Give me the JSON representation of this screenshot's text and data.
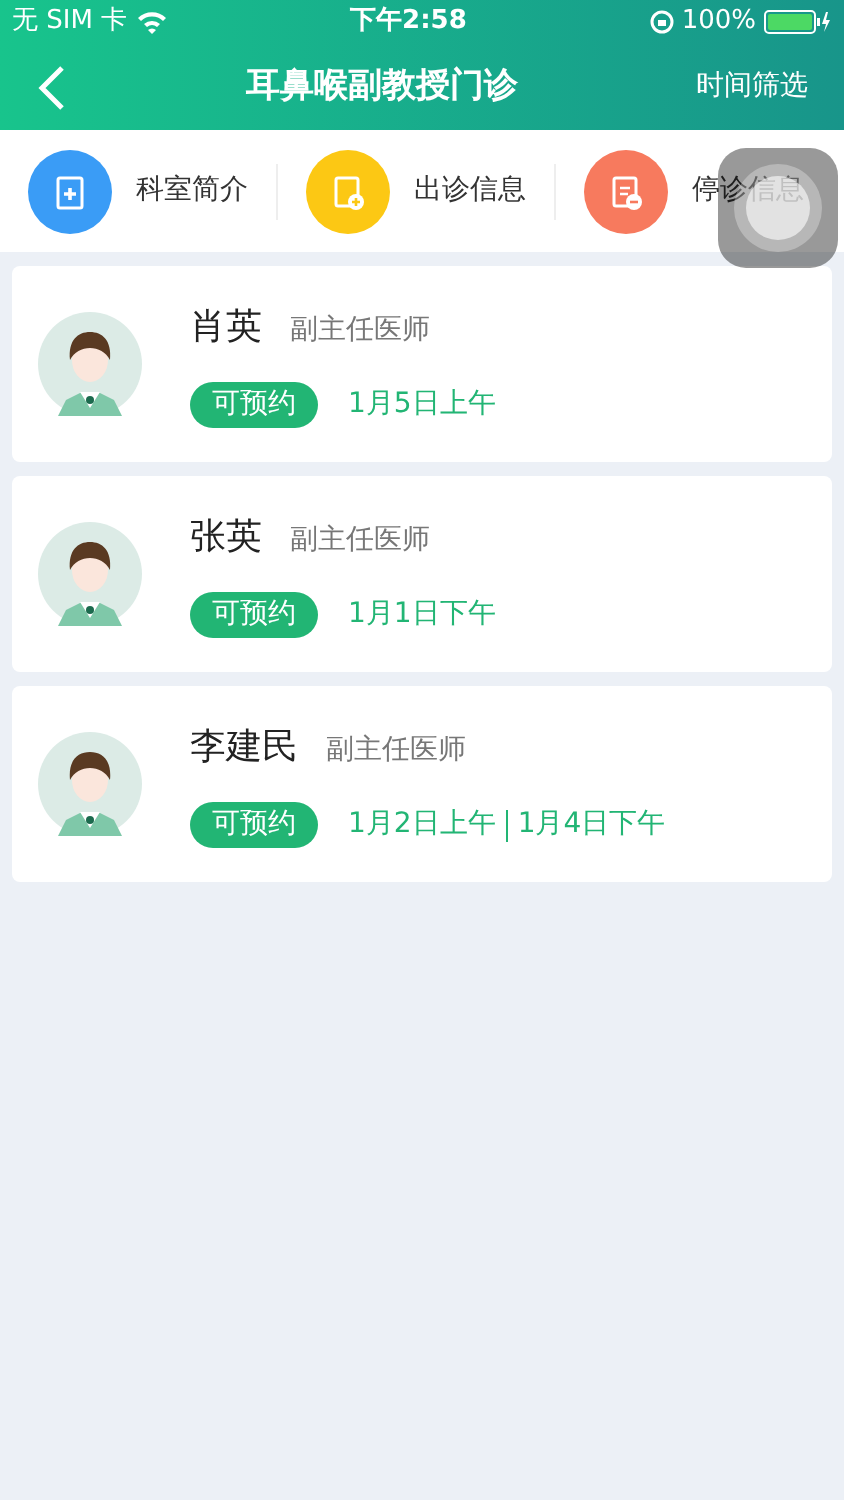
{
  "status_bar": {
    "carrier": "无 SIM 卡",
    "time": "下午2:58",
    "battery": "100%"
  },
  "header": {
    "title": "耳鼻喉副教授门诊",
    "action": "时间筛选"
  },
  "shortcuts": [
    {
      "label": "科室简介",
      "kind": "intro",
      "color": "#3a9cf6"
    },
    {
      "label": "出诊信息",
      "kind": "schedule",
      "color": "#fcc814"
    },
    {
      "label": "停诊信息",
      "kind": "stopped",
      "color": "#f77a5e"
    }
  ],
  "doctors": [
    {
      "name": "肖英",
      "title": "副主任医师",
      "badge": "可预约",
      "slots": [
        "1月5日上午"
      ]
    },
    {
      "name": "张英",
      "title": "副主任医师",
      "badge": "可预约",
      "slots": [
        "1月1日下午"
      ]
    },
    {
      "name": "李建民",
      "title": "副主任医师",
      "badge": "可预约",
      "slots": [
        "1月2日上午",
        "1月4日下午"
      ]
    }
  ]
}
